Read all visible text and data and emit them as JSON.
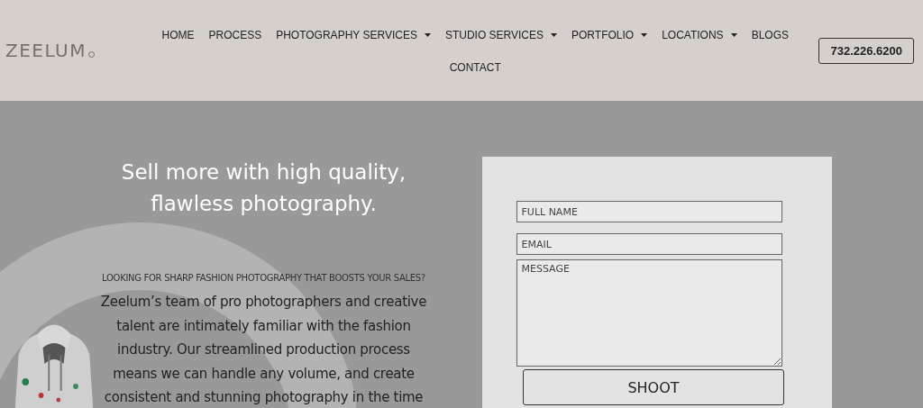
{
  "header": {
    "logo": "ZEELUM",
    "nav": [
      {
        "label": "HOME",
        "has_dropdown": false
      },
      {
        "label": "PROCESS",
        "has_dropdown": false
      },
      {
        "label": "PHOTOGRAPHY SERVICES",
        "has_dropdown": true
      },
      {
        "label": "STUDIO SERVICES",
        "has_dropdown": true
      },
      {
        "label": "PORTFOLIO",
        "has_dropdown": true
      },
      {
        "label": "LOCATIONS",
        "has_dropdown": true
      },
      {
        "label": "BLOGS",
        "has_dropdown": false
      },
      {
        "label": "CONTACT",
        "has_dropdown": false
      }
    ],
    "phone": "732.226.6200"
  },
  "hero": {
    "headline": "Sell more with high quality, flawless photography.",
    "question": "LOOKING FOR SHARP FASHION PHOTOGRAPHY THAT BOOSTS YOUR SALES?",
    "body": "Zeelum’s team of pro photographers and creative talent are intimately familiar with the fashion industry. Our streamlined production process means we can handle any volume, and create consistent and stunning photography in the time"
  },
  "form": {
    "fields": [
      {
        "kind": "input",
        "placeholder": "FULL NAME"
      },
      {
        "kind": "input",
        "placeholder": "EMAIL"
      },
      {
        "kind": "textarea",
        "placeholder": "MESSAGE"
      }
    ],
    "submit": "SHOOT"
  }
}
